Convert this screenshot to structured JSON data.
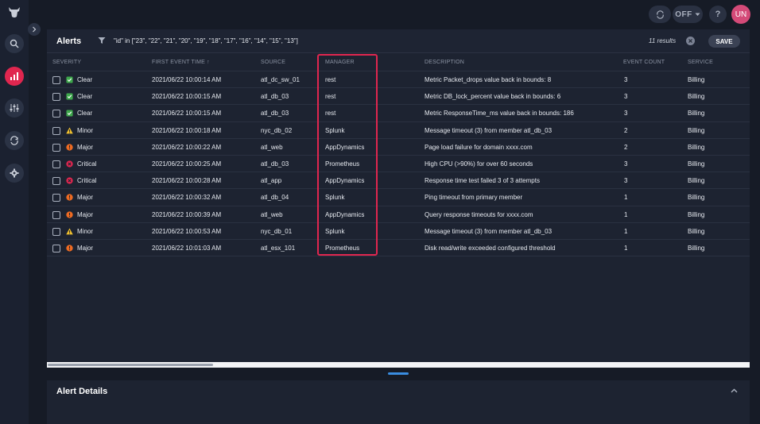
{
  "topbar": {
    "off_label": "OFF",
    "avatar_initials": "UN"
  },
  "alerts": {
    "title": "Alerts",
    "filter": "\"id\" in [\"23\", \"22\", \"21\", \"20\", \"19\", \"18\", \"17\", \"16\", \"14\", \"15\", \"13\"]",
    "results": "11 results",
    "save_label": "SAVE",
    "columns": {
      "severity": "SEVERITY",
      "first_event_time": "FIRST EVENT TIME ↑",
      "source": "SOURCE",
      "manager": "MANAGER",
      "description": "DESCRIPTION",
      "event_count": "EVENT COUNT",
      "service": "SERVICE"
    },
    "rows": [
      {
        "severity": "Clear",
        "time": "2021/06/22 10:00:14 AM",
        "source": "atl_dc_sw_01",
        "manager": "rest",
        "description": "Metric Packet_drops value back in bounds: 8",
        "count": "3",
        "service": "Billing"
      },
      {
        "severity": "Clear",
        "time": "2021/06/22 10:00:15 AM",
        "source": "atl_db_03",
        "manager": "rest",
        "description": "Metric DB_lock_percent value back in bounds: 6",
        "count": "3",
        "service": "Billing"
      },
      {
        "severity": "Clear",
        "time": "2021/06/22 10:00:15 AM",
        "source": "atl_db_03",
        "manager": "rest",
        "description": "Metric ResponseTime_ms value back in bounds: 186",
        "count": "3",
        "service": "Billing"
      },
      {
        "severity": "Minor",
        "time": "2021/06/22 10:00:18 AM",
        "source": "nyc_db_02",
        "manager": "Splunk",
        "description": "Message timeout (3) from member atl_db_03",
        "count": "2",
        "service": "Billing"
      },
      {
        "severity": "Major",
        "time": "2021/06/22 10:00:22 AM",
        "source": "atl_web",
        "manager": "AppDynamics",
        "description": "Page load failure for domain xxxx.com",
        "count": "2",
        "service": "Billing"
      },
      {
        "severity": "Critical",
        "time": "2021/06/22 10:00:25 AM",
        "source": "atl_db_03",
        "manager": "Prometheus",
        "description": "High CPU (>90%) for over 60 seconds",
        "count": "3",
        "service": "Billing"
      },
      {
        "severity": "Critical",
        "time": "2021/06/22 10:00:28 AM",
        "source": "atl_app",
        "manager": "AppDynamics",
        "description": "Response time test failed 3 of 3 attempts",
        "count": "3",
        "service": "Billing"
      },
      {
        "severity": "Major",
        "time": "2021/06/22 10:00:32 AM",
        "source": "atl_db_04",
        "manager": "Splunk",
        "description": "Ping timeout from primary member",
        "count": "1",
        "service": "Billing"
      },
      {
        "severity": "Major",
        "time": "2021/06/22 10:00:39 AM",
        "source": "atl_web",
        "manager": "AppDynamics",
        "description": "Query response timeouts for xxxx.com",
        "count": "1",
        "service": "Billing"
      },
      {
        "severity": "Minor",
        "time": "2021/06/22 10:00:53 AM",
        "source": "nyc_db_01",
        "manager": "Splunk",
        "description": "Message timeout (3) from member atl_db_03",
        "count": "1",
        "service": "Billing"
      },
      {
        "severity": "Major",
        "time": "2021/06/22 10:01:03 AM",
        "source": "atl_esx_101",
        "manager": "Prometheus",
        "description": "Disk read/write exceeded configured threshold",
        "count": "1",
        "service": "Billing"
      }
    ]
  },
  "details": {
    "title": "Alert Details"
  },
  "severity_colors": {
    "Clear": "#3ea84c",
    "Minor": "#f2c12e",
    "Major": "#ef6b22",
    "Critical": "#e0264f"
  },
  "icons": [
    "bull-logo-icon",
    "search-icon",
    "dashboard-icon",
    "sliders-icon",
    "sync-icon",
    "gear-icon",
    "chevron-right-icon",
    "refresh-icon",
    "help-icon",
    "filter-icon",
    "clear-icon",
    "chevron-up-icon"
  ]
}
